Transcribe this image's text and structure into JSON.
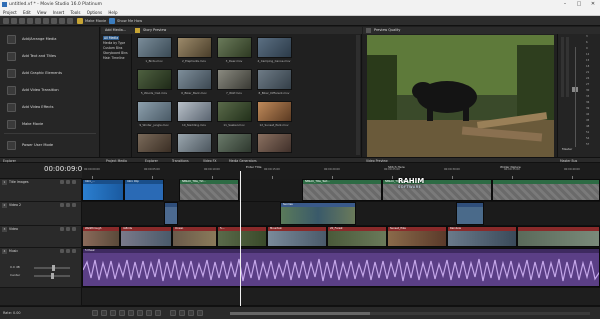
{
  "window": {
    "title": "untitled.vf * - Movie Studio 16.0 Platinum",
    "controls": [
      "–",
      "□",
      "✕"
    ]
  },
  "menu": [
    "Project",
    "Edit",
    "View",
    "Insert",
    "Tools",
    "Options",
    "Help"
  ],
  "toolbar": {
    "make_movie": "Make Movie",
    "show_me_how": "Show Me How"
  },
  "left_panel": {
    "items": [
      {
        "label": "Add/Arrange Media",
        "icon": "add-media-icon"
      },
      {
        "label": "Add Text and Titles",
        "icon": "text-icon"
      },
      {
        "label": "Add Graphic Elements",
        "icon": "graphic-icon"
      },
      {
        "label": "Add Video Transition",
        "icon": "transition-icon"
      },
      {
        "label": "Add Video Effects",
        "icon": "fx-icon"
      },
      {
        "label": "Make Movie",
        "icon": "make-movie-icon"
      },
      {
        "label": "Power User Mode",
        "icon": "power-user-icon"
      }
    ],
    "footer_tab": "Explorer"
  },
  "tree": {
    "header": "Add Media...",
    "items": [
      "All Media",
      "Media by Type",
      "Custom Bins",
      "Storyboard Bins",
      "Main Timeline"
    ]
  },
  "media": {
    "header": "Story Preview",
    "items": [
      "1_Birds.mov",
      "2_Elephants.mov",
      "3_Deer.mov",
      "4_Camping_Canoe.mov",
      "5_Woods_trail.mov",
      "6_Biker_Back.mov",
      "7_Wolf.mov",
      "8_Biker_Different.mov",
      "9_Winter_jungle.mov",
      "10_Sledding.mov",
      "11_Seeker.mov",
      "12_Sunset_Park.mov",
      "",
      "",
      "",
      ""
    ]
  },
  "preview": {
    "header": "Preview Quality",
    "info_left": [
      "Project: 960x540x32, 25.000p",
      "Preview: 480x270x32, 25.000p",
      "Display: 292x164x32"
    ],
    "info_right": [
      "Frame: 226",
      "Display: 292x164x32"
    ],
    "footer_tab": "Video Preview"
  },
  "meter": {
    "header": "Master",
    "ticks": [
      "3",
      "6",
      "9",
      "12",
      "15",
      "18",
      "21",
      "24",
      "27",
      "30",
      "33",
      "36",
      "39",
      "42",
      "45",
      "48",
      "51",
      "54",
      "57"
    ],
    "footer_tab": "Master Bus"
  },
  "tabs": [
    "Explorer",
    "Project Media",
    "Explorer",
    "Transitions",
    "Video FX",
    "Media Generators"
  ],
  "timeline": {
    "timecode": "00:00:09:06",
    "ruler_times": [
      "00:00:00:00",
      "00:00:05:00",
      "00:00:10:00",
      "00:00:15:00",
      "00:00:20:00",
      "00:00:25:00",
      "00:00:30:00",
      "00:00:35:00",
      "00:00:40:00"
    ],
    "markers": [
      "Enter Title",
      "Stitch Here",
      "Wilder Nature"
    ],
    "tracks": [
      {
        "num": "1",
        "name": "Title Images"
      },
      {
        "num": "2",
        "name": "Video 2"
      },
      {
        "num": "3",
        "name": "Video"
      },
      {
        "num": "4",
        "name": "Music"
      }
    ],
    "music_level": "0.0 dB",
    "music_pan": "Center",
    "clip_labels": [
      "Intro_...",
      "Intro Clip",
      "NBSAU_Title_Txt...",
      "NBSAU_Title_Text...",
      "NBSAU_Title_Text...",
      "Sunrise",
      "Walkthrough",
      "4-Birds",
      "Ocean",
      "5-...",
      "Mountain",
      "20_Forest",
      "Sunset_Hike",
      "Rainbow",
      "5 Music"
    ]
  },
  "watermark": {
    "brand": "RAHIM",
    "sub": "SOFTWARE"
  },
  "status": "Rate: 0.00"
}
